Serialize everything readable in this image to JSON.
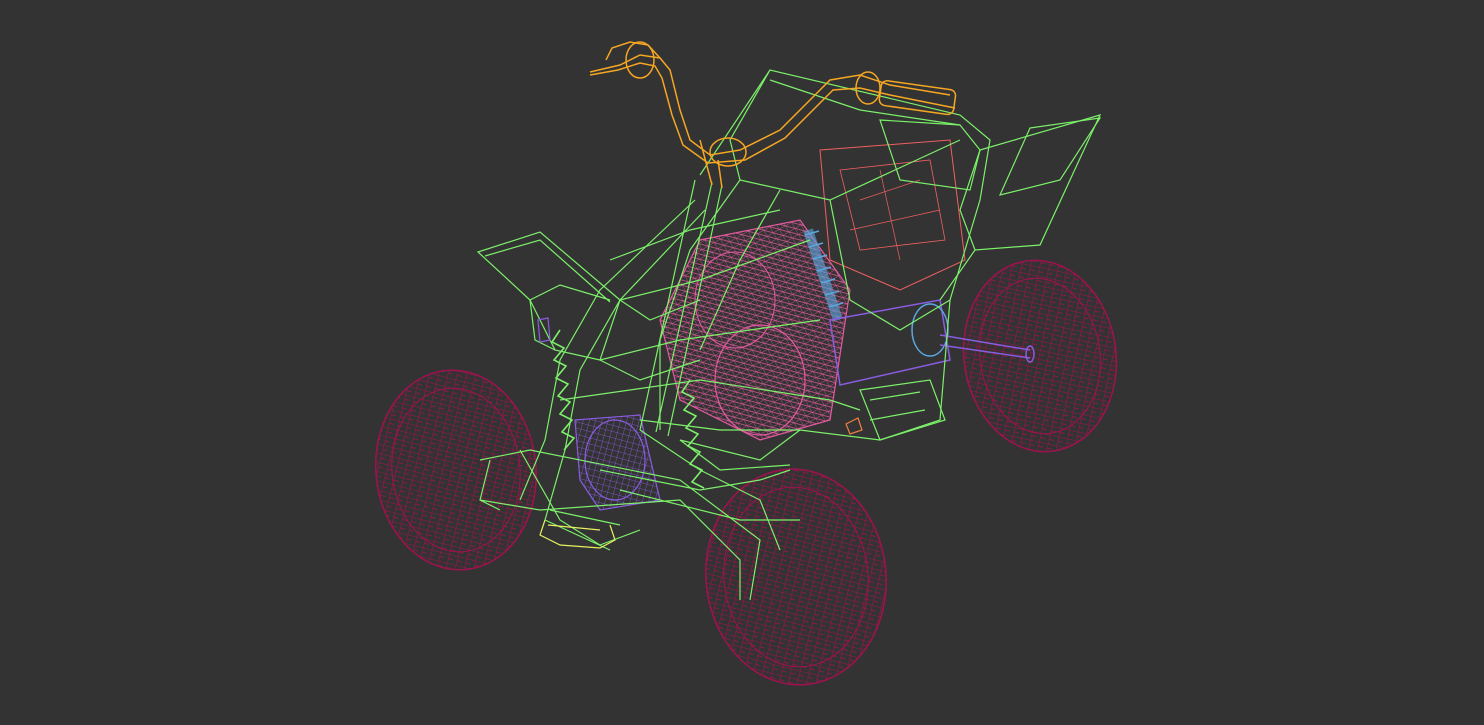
{
  "viewport": {
    "background": "#333333",
    "mode": "wireframe",
    "subject": "atv-quad-bike"
  },
  "colors": {
    "frame": "#7CF06A",
    "handlebar": "#F5A623",
    "tire": "#A0124E",
    "engine": "#E45AA0",
    "engine_detail": "#F06060",
    "suspension_blue": "#5AA8E0",
    "purple": "#8A5CE0",
    "yellow": "#E8F060",
    "orange_detail": "#F08040"
  }
}
